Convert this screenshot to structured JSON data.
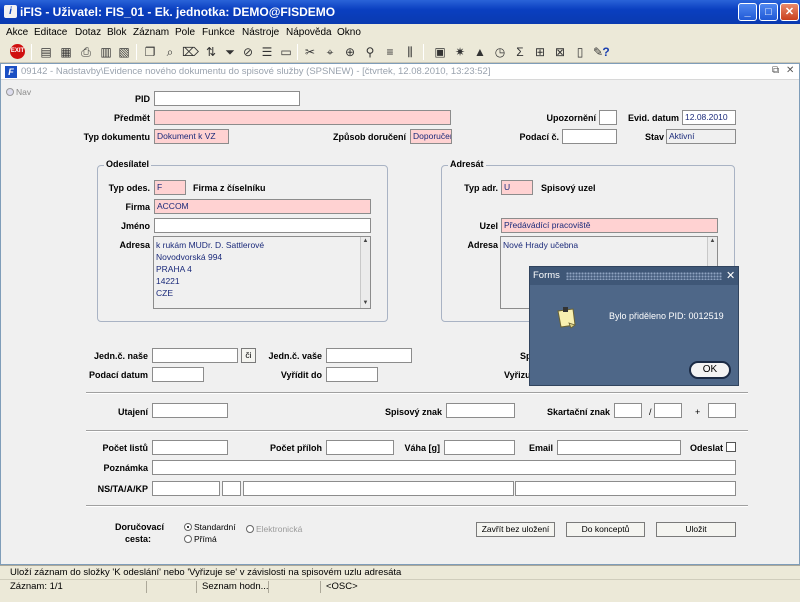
{
  "window": {
    "title": "iFIS - Uživatel: FIS_01 - Ek. jednotka: DEMO@FISDEMO",
    "app_icon": "ifis-icon"
  },
  "menu": [
    "Akce",
    "Editace",
    "Dotaz",
    "Blok",
    "Záznam",
    "Pole",
    "Funkce",
    "Nástroje",
    "Nápověda",
    "Okno"
  ],
  "toolbar": {
    "exit_label": "EXIT"
  },
  "inner": {
    "title": "09142 - Nadstavby\\Evidence nového dokumentu do spisové služby (SPSNEW) - [čtvrtek, 12.08.2010, 13:23:52]"
  },
  "nav": {
    "label": "Nav"
  },
  "form": {
    "pid_label": "PID",
    "pid": "",
    "predmet_label": "Předmět",
    "predmet": "",
    "upozorneni_label": "Upozornění",
    "upozorneni": "",
    "evid_datum_label": "Evid. datum",
    "evid_datum": "12.08.2010",
    "typ_dokumentu_label": "Typ dokumentu",
    "typ_dokumentu": "Dokument k VZ",
    "zpusob_doruceni_label": "Způsob doručení",
    "zpusob_doruceni": "Doporučeně",
    "podaci_c_label": "Podací č.",
    "podaci_c": "",
    "stav_label": "Stav",
    "stav": "Aktivní"
  },
  "odesilatel": {
    "title": "Odesílatel",
    "typ_odes_label": "Typ odes.",
    "typ_odes": "F",
    "typ_odes_desc": "Firma z číselníku",
    "firma_label": "Firma",
    "firma": "ACCOM",
    "jmeno_label": "Jméno",
    "jmeno": "",
    "adresa_label": "Adresa",
    "adresa": [
      "k rukám MUDr. D. Sattlerové",
      "Novodvorská 994",
      "PRAHA 4",
      "14221",
      "CZE"
    ]
  },
  "adresat": {
    "title": "Adresát",
    "typ_adr_label": "Typ adr.",
    "typ_adr": "U",
    "typ_adr_desc": "Spisový uzel",
    "uzel_label": "Uzel",
    "uzel": "Předávádící pracoviště",
    "adresa_label": "Adresa",
    "adresa": "Nové Hrady učebna"
  },
  "jednaci": {
    "jedn_nase_label": "Jedn.č. naše",
    "jedn_nase": "",
    "ci_button": "či",
    "jedn_vase_label": "Jedn.č. vaše",
    "jedn_vase": "",
    "podaci_datum_label": "Podací datum",
    "podaci_datum": "",
    "vyridit_do_label": "Vyřídit do",
    "vyridit_do": "",
    "hidden1_label": "Sp",
    "hidden2_label": "Vyřizu"
  },
  "spisove": {
    "utajeni_label": "Utajení",
    "utajeni": "",
    "spisovy_znak_label": "Spisový znak",
    "spisovy_znak": "",
    "skartacni_znak_label": "Skartační znak",
    "skartacni_znak": "",
    "slash": "/",
    "plus": "+"
  },
  "listy": {
    "pocet_listu_label": "Počet listů",
    "pocet_listu": "",
    "pocet_priloh_label": "Počet příloh",
    "pocet_priloh": "",
    "vaha_label": "Váha [g]",
    "vaha": "",
    "email_label": "Email",
    "email": "",
    "odeslat_label": "Odeslat",
    "poznamka_label": "Poznámka",
    "poznamka": "",
    "nstakp_label": "NS/TA/A/KP"
  },
  "bottom": {
    "dorucovaci_label": "Doručovací",
    "cesta_label": "cesta:",
    "radio_standardni": "Standardní",
    "radio_elektronicka": "Elektronická",
    "radio_prima": "Přímá",
    "zavrit_button": "Zavřít bez uložení",
    "do_konceptu_button": "Do konceptů",
    "ulozit_button": "Uložit"
  },
  "status": {
    "message": "Uloží záznam do složky 'K odeslání' nebo 'Vyřizuje se' v závislosti na spisovém uzlu adresáta",
    "zaznam": "Záznam: 1/1",
    "seznam": "Seznam hodn...",
    "osc": "<OSC>"
  },
  "dialog": {
    "title": "Forms",
    "message": "Bylo přiděleno PID: 0012519",
    "ok_button": "OK"
  }
}
